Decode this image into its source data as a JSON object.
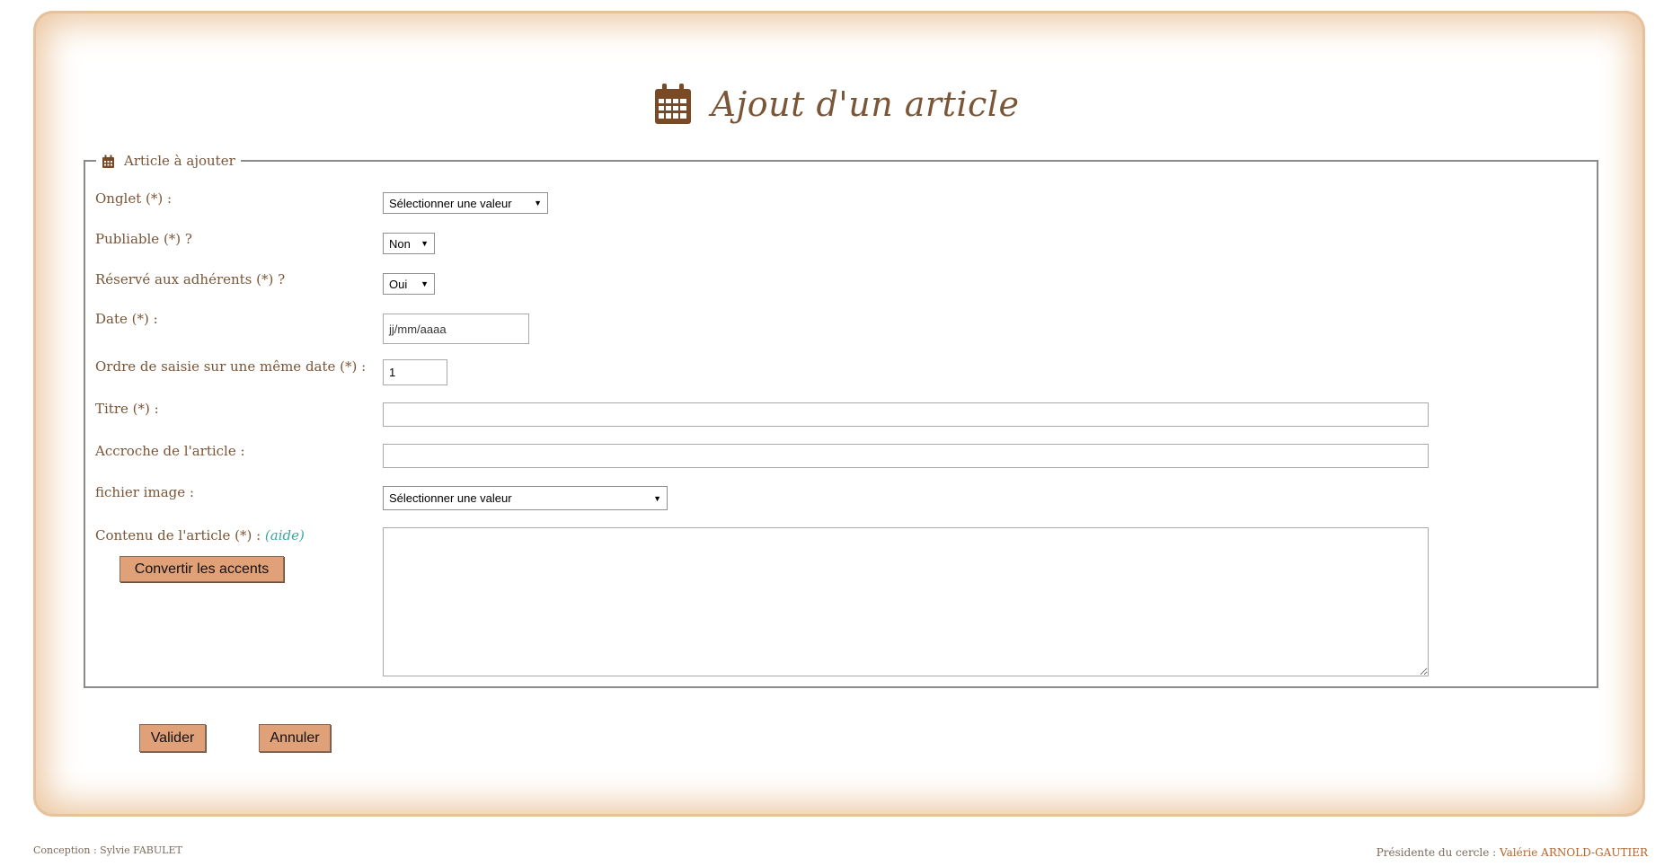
{
  "page": {
    "title": "Ajout d'un article",
    "title_icon": "calendar-icon"
  },
  "fieldset": {
    "legend": "Article à ajouter",
    "legend_icon": "calendar-icon"
  },
  "fields": {
    "onglet": {
      "label": "Onglet (*) :",
      "value": "Sélectionner une valeur"
    },
    "publiable": {
      "label": "Publiable (*) ?",
      "value": "Non"
    },
    "reserve": {
      "label": "Réservé aux adhérents (*) ?",
      "value": "Oui"
    },
    "date": {
      "label": "Date (*) :",
      "value": "jj/mm/aaaa"
    },
    "ordre": {
      "label": "Ordre de saisie sur une même date (*) :",
      "value": "1"
    },
    "titre": {
      "label": "Titre (*) :",
      "value": ""
    },
    "accroche": {
      "label": "Accroche de l'article :",
      "value": ""
    },
    "fichier_image": {
      "label": "fichier image :",
      "value": "Sélectionner une valeur"
    },
    "contenu": {
      "label": "Contenu de l'article (*) :",
      "help_link": "(aide)",
      "value": ""
    }
  },
  "buttons": {
    "convert": "Convertir les accents",
    "validate": "Valider",
    "cancel": "Annuler"
  },
  "footer": {
    "conception": "Conception : Sylvie FABULET",
    "president_label": "Présidente du cercle :",
    "president_name": "Valérie ARNOLD-GAUTIER"
  },
  "colors": {
    "accent_brown": "#7a5536",
    "frame_glow": "#ecc8a3",
    "button_bg": "#e0a078",
    "help_link": "#3aa6a0"
  }
}
